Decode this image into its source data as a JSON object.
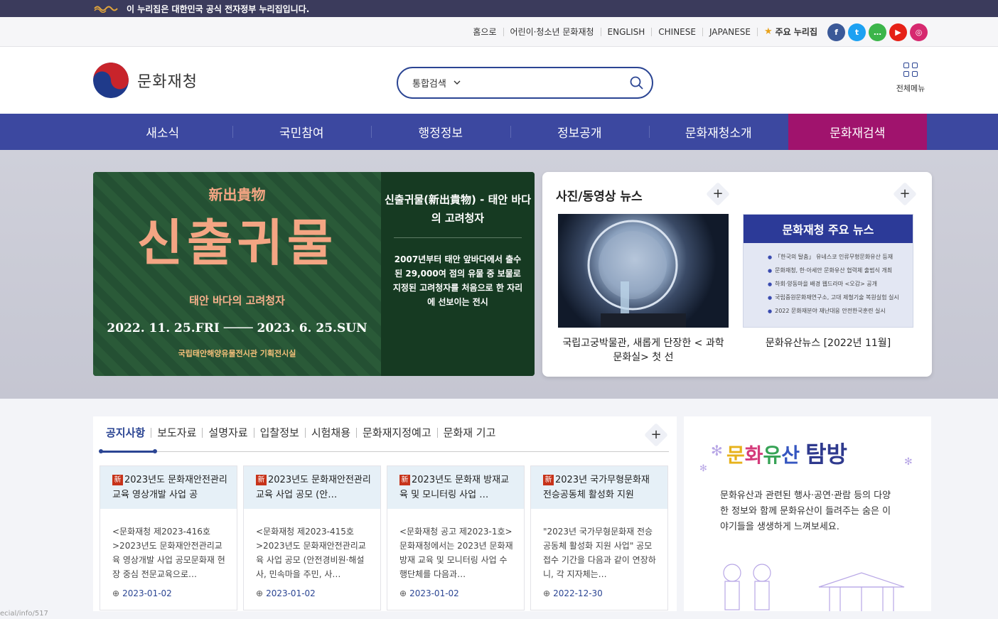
{
  "gov_bar": {
    "text": "이 누리집은 대한민국 공식 전자정부 누리집입니다."
  },
  "util": {
    "links": [
      "홈으로",
      "어린이·청소년 문화재청",
      "ENGLISH",
      "CHINESE",
      "JAPANESE"
    ],
    "favorites": "주요 누리집",
    "social": [
      {
        "icon": "facebook-icon",
        "glyph": "f",
        "color": "#3b5998"
      },
      {
        "icon": "twitter-icon",
        "glyph": "t",
        "color": "#1da1f2"
      },
      {
        "icon": "talk-icon",
        "glyph": "…",
        "color": "#3cb54a"
      },
      {
        "icon": "youtube-icon",
        "glyph": "▶",
        "color": "#e62117"
      },
      {
        "icon": "instagram-icon",
        "glyph": "◎",
        "color": "#d6296f"
      }
    ]
  },
  "header": {
    "brand": "문화재청",
    "search_scope": "통합검색",
    "search_value": "",
    "all_menu": "전체메뉴"
  },
  "nav": [
    {
      "label": "새소식",
      "active": false
    },
    {
      "label": "국민참여",
      "active": false
    },
    {
      "label": "행정정보",
      "active": false
    },
    {
      "label": "정보공개",
      "active": false
    },
    {
      "label": "문화재청소개",
      "active": false
    },
    {
      "label": "문화재검색",
      "active": true
    }
  ],
  "banner": {
    "kanji": "新出貴物",
    "title": "신출귀물",
    "subtitle": "태안 바다의 고려청자",
    "dates": "2022. 11. 25.FRI ──── 2023. 6. 25.SUN",
    "venue": "국립태안해양유물전시관 기획전시실",
    "right_title": "신출귀물(新出貴物) - 태안 바다의 고려청자",
    "right_desc": "2007년부터 태안 앞바다에서 출수된 29,000여 점의 유물 중 보물로 지정된 고려청자를 처음으로 한 자리에 선보이는 전시"
  },
  "media": {
    "title": "사진/동영상 뉴스",
    "items": [
      {
        "caption": "국립고궁박물관, 새롭게 단장한 < 과학문화실> 첫 선"
      },
      {
        "caption": "문화유산뉴스 [2022년 11월]"
      }
    ],
    "news_thumb": {
      "heading": "문화재청 주요 뉴스",
      "rows": [
        "「한국의 탈춤」 유네스코 인류무형문화유산 등재",
        "문화재청, 한·아세안 문화유산 협력체 출범식 개최",
        "하회·양동마을 배경 웹드라마 <오감> 공개",
        "국립중원문화재연구소, 고대 제철기술 복원실험 실시",
        "2022 문화재분야 재난대응 안전한국훈련 실시"
      ]
    }
  },
  "notice": {
    "tabs": [
      "공지사항",
      "보도자료",
      "설명자료",
      "입찰정보",
      "시험채용",
      "문화재지정예고",
      "문화재 기고"
    ],
    "new_badge": "新",
    "cards": [
      {
        "title": "2023년도 문화재안전관리교육 영상개발 사업 공",
        "body": "<문화재청 제2023-416호>2023년도 문화재안전관리교육 영상개발 사업 공모문화재 현장 중심 전문교육으로…",
        "date": "2023-01-02"
      },
      {
        "title": "2023년도 문화재안전관리교육 사업 공모 (안…",
        "body": "<문화재청 제2023-415호>2023년도 문화재안전관리교육 사업 공모 (안전경비원·해설사, 민속마을 주민, 사…",
        "date": "2023-01-02"
      },
      {
        "title": "2023년도 문화재 방재교육 및 모니터링 사업 …",
        "body": "<문화재청 공고 제2023-1호>문화재청에서는 2023년 문화재 방재 교육 및 모니터링 사업 수행단체를 다음과…",
        "date": "2023-01-02"
      },
      {
        "title": "2023년 국가무형문화재 전승공동체 활성화 지원",
        "body": "\"2023년 국가무형문화재 전승공동체 활성화 지원 사업\" 공모 접수 기간을 다음과 같이 연장하니, 각 지자체는…",
        "date": "2022-12-30"
      }
    ]
  },
  "heritage": {
    "title_parts": [
      "문",
      "화",
      "유",
      "산",
      "탐방"
    ],
    "desc": "문화유산과 관련된 행사·공연·관람 등의 다양한 정보와 함께 문화유산이 들려주는 숨은 이야기들을 생생하게 느껴보세요."
  },
  "footnote": "ecial/info/517"
}
